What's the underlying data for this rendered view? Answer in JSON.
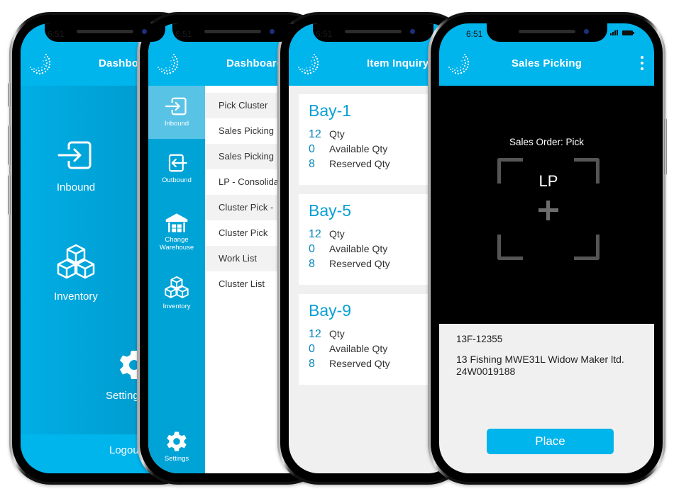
{
  "status_bar": {
    "time": "6:51"
  },
  "phones": {
    "dashboard": {
      "title": "Dashboard",
      "tiles": [
        {
          "label": "Inbound",
          "icon": "login-arrow-icon"
        },
        {
          "label": "Inventory",
          "icon": "boxes-icon"
        },
        {
          "label": "Settings",
          "icon": "gear-icon"
        }
      ],
      "logout_label": "Logout"
    },
    "menu": {
      "title": "Dashboard",
      "side_nav": [
        {
          "label": "Inbound",
          "icon": "login-arrow-icon",
          "active": true
        },
        {
          "label": "Outbound",
          "icon": "logout-arrow-icon",
          "active": false
        },
        {
          "label": "Change Warehouse",
          "icon": "warehouse-icon",
          "active": false
        },
        {
          "label": "Inventory",
          "icon": "boxes-icon",
          "active": false
        },
        {
          "label": "Settings",
          "icon": "gear-icon",
          "active": false
        }
      ],
      "items": [
        "Pick Cluster",
        "Sales Picking",
        "Sales Picking",
        "LP - Consolidation",
        "Cluster Pick -",
        "Cluster Pick",
        "Work List",
        "Cluster List"
      ]
    },
    "item_inquiry": {
      "title": "Item Inquiry",
      "bays": [
        {
          "name": "Bay-1",
          "qty": "12",
          "available_qty": "0",
          "reserved_qty": "8"
        },
        {
          "name": "Bay-5",
          "qty": "12",
          "available_qty": "0",
          "reserved_qty": "8"
        },
        {
          "name": "Bay-9",
          "qty": "12",
          "available_qty": "0",
          "reserved_qty": "8"
        }
      ],
      "labels": {
        "qty": "Qty",
        "available_qty": "Available Qty",
        "reserved_qty": "Reserved Qty"
      }
    },
    "sales_picking": {
      "title": "Sales Picking",
      "scan_title": "Sales Order: Pick",
      "scan_target": "LP",
      "order_id": "13F-12355",
      "order_description": "13 Fishing MWE31L Widow Maker ltd. 24W0019188",
      "place_label": "Place"
    }
  },
  "colors": {
    "brand": "#00b4ec",
    "nav_dark": "#00a3d6",
    "nav_active": "#59c3e6",
    "bay_title": "#0a9fd4",
    "panel_bg": "#f0f0f0"
  }
}
